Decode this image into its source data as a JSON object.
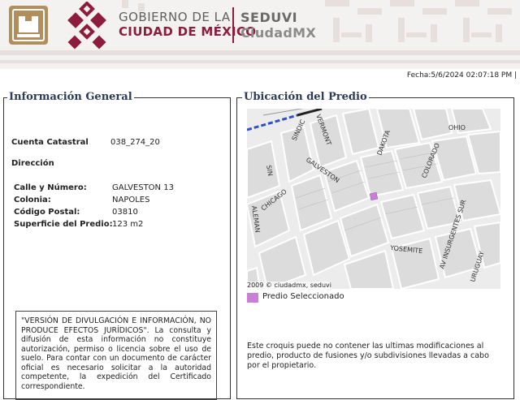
{
  "header": {
    "gob_line1": "GOBIERNO DE LA",
    "gob_line2": "CIUDAD DE MÉXICO",
    "agency": "SEDUVI",
    "platform": "CiudadMX"
  },
  "fecha": "Fecha:5/6/2024 02:07:18 PM |",
  "info": {
    "title": "Información General",
    "cuenta_label": "Cuenta Catastral",
    "cuenta_value": "038_274_20",
    "direccion_label": "Dirección",
    "calle_label": "Calle y Número:",
    "calle_value": "GALVESTON 13",
    "colonia_label": "Colonia:",
    "colonia_value": "NAPOLES",
    "cp_label": "Código Postal:",
    "cp_value": "03810",
    "sup_label": "Superficie del Predio:",
    "sup_value": "123 m2",
    "note": "\"VERSIÓN DE DIVULGACIÓN E INFORMACIÓN, NO PRODUCE EFECTOS JURÍDICOS\". La consulta y difusión de esta información no constituye autorización, permiso o licencia sobre el uso de suelo. Para contar con un documento de carácter oficial es necesario solicitar a la autoridad competente, la expedición del Certificado correspondiente."
  },
  "ubicacion": {
    "title": "Ubicación del Predio",
    "streets": {
      "sindicato": "SINDIC",
      "vermont": "VERMONT",
      "dakota": "DAKOTA",
      "ohio": "OHIO",
      "colorado": "COLORADO",
      "galveston": "GALVESTON",
      "chicago": "CHICAGO",
      "sin": "SIN",
      "aleman": "ALEMAN",
      "yosemite": "YOSEMITE",
      "insurgentes": "AV INSURGENTES SUR",
      "uruguay": "URUGUAY"
    },
    "copyright": "2009 © ciudadmx, seduvi",
    "legend_label": "Predio Seleccionado",
    "note": "Este croquis puede no contener las ultimas modificaciones al predio, producto de fusiones y/o subdivisiones llevadas a cabo por el propietario."
  },
  "colors": {
    "brand": "#8e1c3e",
    "selected_parcel": "#c97fd6"
  }
}
